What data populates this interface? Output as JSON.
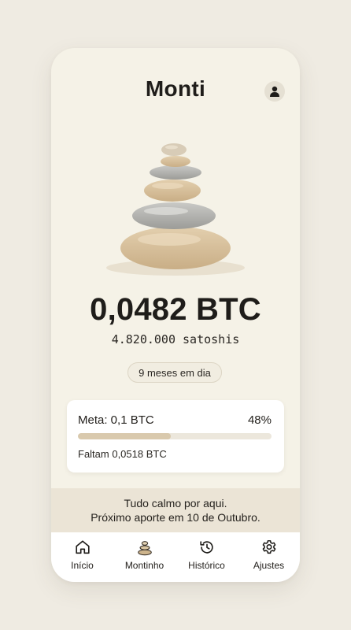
{
  "header": {
    "title": "Monti",
    "profile_icon": "user-icon"
  },
  "illustration": {
    "icon": "stacked-stones-illustration"
  },
  "balance": {
    "btc": "0,0482 BTC",
    "satoshis": "4.820.000 satoshis"
  },
  "streak": {
    "label": "9 meses em dia"
  },
  "goal": {
    "label": "Meta: 0,1 BTC",
    "percent_label": "48%",
    "progress": 0.48,
    "remaining": "Faltam 0,0518 BTC"
  },
  "message": {
    "line1": "Tudo calmo por aqui.",
    "line2": "Próximo aporte em 10 de Outubro."
  },
  "tabs": [
    {
      "label": "Início",
      "icon": "home-icon"
    },
    {
      "label": "Montinho",
      "icon": "stones-icon"
    },
    {
      "label": "Histórico",
      "icon": "history-icon"
    },
    {
      "label": "Ajustes",
      "icon": "gear-icon"
    }
  ],
  "colors": {
    "background": "#efebe2",
    "card": "#f5f2e7",
    "progress_fill": "#d9c9ad",
    "banner": "#ebe4d6"
  }
}
